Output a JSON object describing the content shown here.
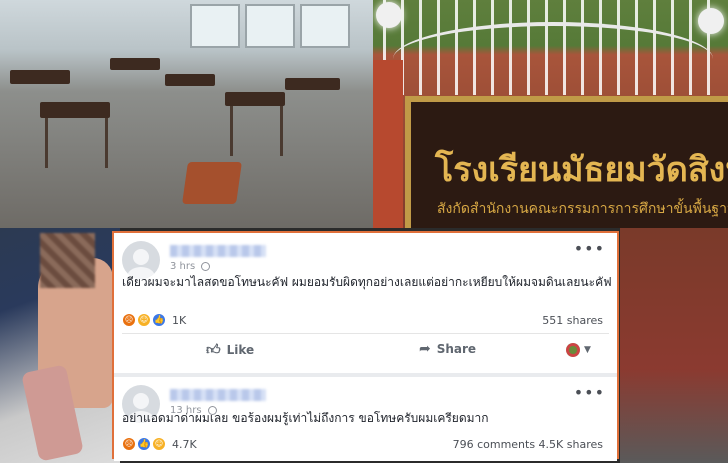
{
  "school_sign": {
    "title": "โรงเรียนมัธยมวัดสิงห์",
    "subtitle": "สังกัดสำนักงานคณะกรรมการการศึกษาขั้นพื้นฐาน"
  },
  "posts": [
    {
      "time": "3 hrs",
      "text": "เดียวผมจะมาไลสดขอโทษนะคัฟ ผมยอมรับผิดทุกอย่างเลยแต่อย่ากะเหยียบให้ผมจมดินเลยนะคัฟ",
      "reaction_count": "1K",
      "shares": "551 shares",
      "reactions": [
        "angry",
        "haha",
        "like"
      ]
    },
    {
      "time": "13 hrs",
      "text": "อย่าแอดมาด่าผมเลย ขอร้องผมรู้เท่าไม่ถึงการ ขอโทษครับผมเครียดมาก",
      "reaction_count": "4.7K",
      "shares": "796 comments  4.5K shares",
      "reactions": [
        "angry",
        "like",
        "haha"
      ]
    }
  ],
  "actions": {
    "like_label": "Like",
    "share_label": "Share"
  },
  "icons": {
    "more": "more-options-icon",
    "globe": "globe-icon",
    "like": "thumbs-up-icon",
    "share": "share-arrow-icon"
  },
  "colors": {
    "frame_border": "#e0703a",
    "sign_text": "#e4b652",
    "facebook_gray": "#90949c"
  }
}
